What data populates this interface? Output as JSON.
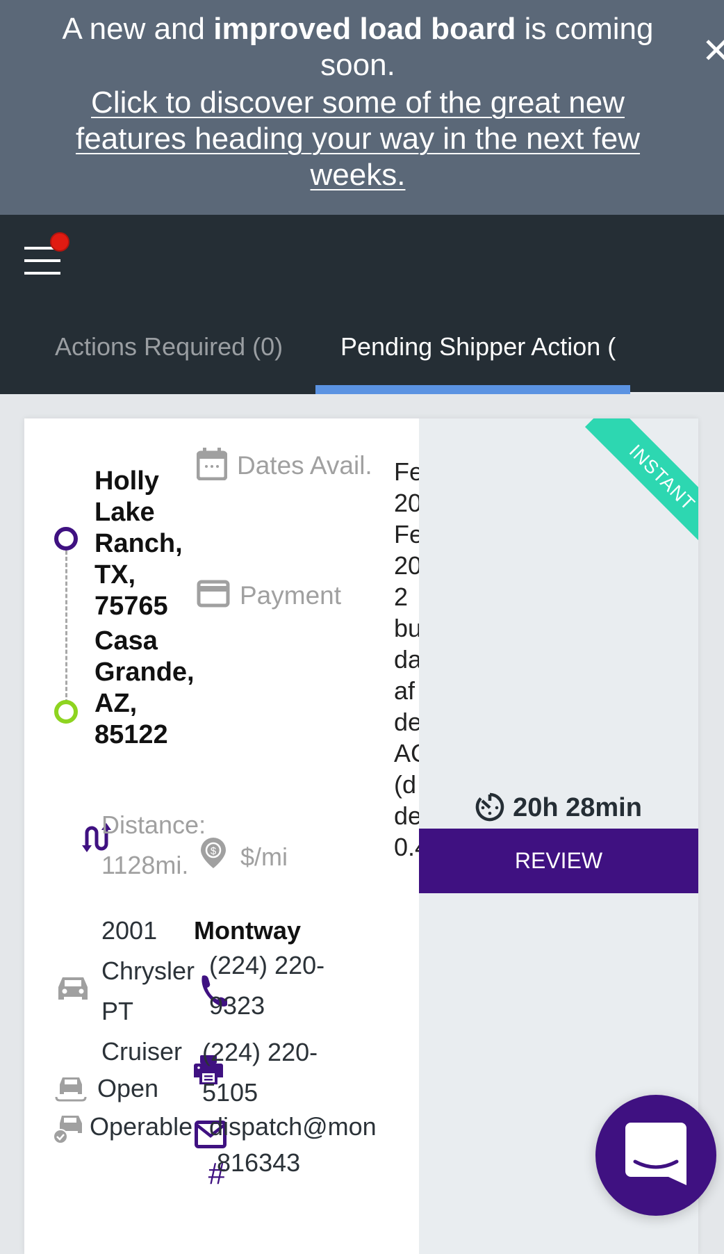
{
  "banner": {
    "headline_pre": "A new and ",
    "headline_bold": "improved load board",
    "headline_post": " is coming soon.",
    "link_text": "Click to discover some of the great new features heading your way in the next few weeks.",
    "close_label": "✕"
  },
  "header": {
    "menu_icon": "hamburger-icon",
    "has_notification": true,
    "tabs": [
      {
        "label": "Actions Required (0)",
        "active": false
      },
      {
        "label": "Pending Shipper Action (",
        "active": true
      }
    ],
    "next_icon": "chevron-right-icon"
  },
  "load": {
    "badge": "INSTANT",
    "origin": "Holly Lake Ranch, TX, 75765",
    "destination": "Casa Grande, AZ, 85122",
    "dates_label": "Dates Avail.",
    "dates_value_lines": [
      "Fe",
      "20",
      "Fe",
      "20"
    ],
    "payment_label": "Payment",
    "payment_value_lines": [
      "2",
      "bu",
      "da",
      "af",
      "de",
      "AC",
      "(d",
      "de",
      "0.4"
    ],
    "distance_label": "Distance:",
    "distance_value": "1128mi.",
    "price_per_mile_label": "$/mi",
    "vehicle": "2001 Chrysler PT Cruiser",
    "trailer_type": "Open",
    "condition": "Operable",
    "company": "Montway",
    "phone": "(224) 220-9323",
    "fax": "(224) 220-5105",
    "email": "dispatch@mon",
    "order_id": "816343",
    "timer": "20h 28min",
    "review_label": "REVIEW"
  },
  "colors": {
    "banner_bg": "#5b6878",
    "header_bg": "#252e35",
    "tab_indicator": "#5b93e2",
    "brand_purple": "#3f1181",
    "instant_green": "#2dd7b1",
    "destination_green": "#8ed420",
    "notification_red": "#e01b12"
  },
  "chat": {
    "icon": "chat-bubble-icon"
  }
}
